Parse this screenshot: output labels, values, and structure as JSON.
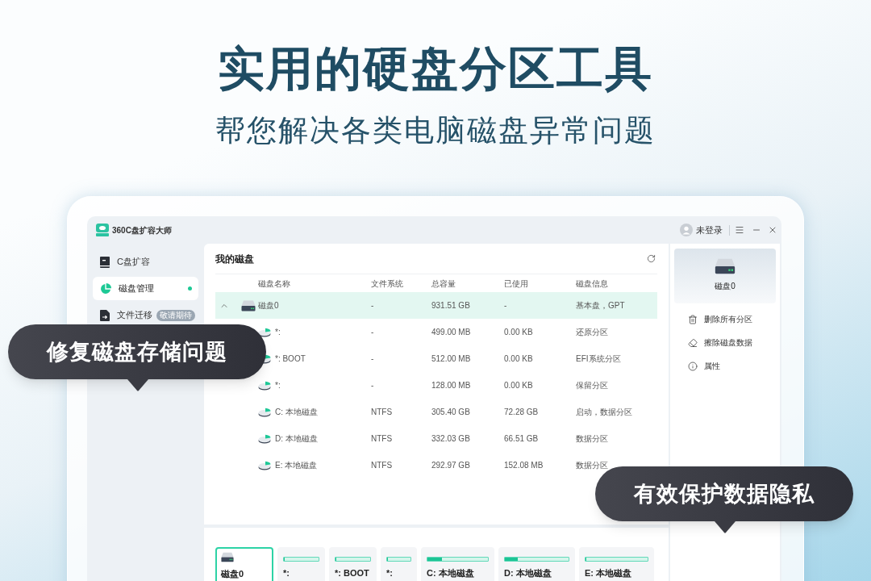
{
  "hero": {
    "title": "实用的硬盘分区工具",
    "subtitle": "帮您解决各类电脑磁盘异常问题"
  },
  "window": {
    "title": "360C盘扩容大师",
    "account": "未登录"
  },
  "sidebar": {
    "items": [
      {
        "label": "C盘扩容",
        "selected": false
      },
      {
        "label": "磁盘管理",
        "selected": true
      },
      {
        "label": "文件迁移",
        "badge": "敬请期待",
        "selected": false
      }
    ]
  },
  "disk_list": {
    "title": "我的磁盘",
    "columns": [
      "磁盘名称",
      "文件系统",
      "总容量",
      "已使用",
      "磁盘信息"
    ],
    "rows": [
      {
        "kind": "disk",
        "expanded": true,
        "selected": true,
        "name": "磁盘0",
        "file_system": "-",
        "total": "931.51 GB",
        "used": "-",
        "info": "基本盘，GPT"
      },
      {
        "kind": "partition",
        "selected": false,
        "name": "*:",
        "file_system": "-",
        "total": "499.00 MB",
        "used": "0.00 KB",
        "info": "还原分区"
      },
      {
        "kind": "partition",
        "selected": false,
        "name": "*: BOOT",
        "file_system": "-",
        "total": "512.00 MB",
        "used": "0.00 KB",
        "info": "EFI系统分区"
      },
      {
        "kind": "partition",
        "selected": false,
        "name": "*:",
        "file_system": "-",
        "total": "128.00 MB",
        "used": "0.00 KB",
        "info": "保留分区"
      },
      {
        "kind": "partition",
        "selected": false,
        "name": "C: 本地磁盘",
        "file_system": "NTFS",
        "total": "305.40 GB",
        "used": "72.28 GB",
        "info": "启动，数据分区"
      },
      {
        "kind": "partition",
        "selected": false,
        "name": "D: 本地磁盘",
        "file_system": "NTFS",
        "total": "332.03 GB",
        "used": "66.51 GB",
        "info": "数据分区"
      },
      {
        "kind": "partition",
        "selected": false,
        "name": "E: 本地磁盘",
        "file_system": "NTFS",
        "total": "292.97 GB",
        "used": "152.08 MB",
        "info": "数据分区"
      }
    ]
  },
  "details": {
    "disk": "磁盘0",
    "actions": [
      "删除所有分区",
      "擦除磁盘数据",
      "属性"
    ]
  },
  "disk_map": {
    "items": [
      {
        "kind": "disk",
        "label": "磁盘0",
        "selected": true
      },
      {
        "kind": "partition",
        "label": "*:",
        "level": 0,
        "selected": false
      },
      {
        "kind": "partition",
        "label": "*: BOOT",
        "level": 0,
        "selected": false
      },
      {
        "kind": "partition",
        "label": "*:",
        "level": 0,
        "selected": false
      },
      {
        "kind": "partition",
        "label": "C: 本地磁盘",
        "level": 0.24,
        "selected": false
      },
      {
        "kind": "partition",
        "label": "D: 本地磁盘",
        "level": 0.2,
        "selected": false
      },
      {
        "kind": "partition",
        "label": "E: 本地磁盘",
        "level": 0,
        "selected": false
      }
    ]
  },
  "callouts": [
    "修复磁盘存储问题",
    "有效保护数据隐私"
  ]
}
